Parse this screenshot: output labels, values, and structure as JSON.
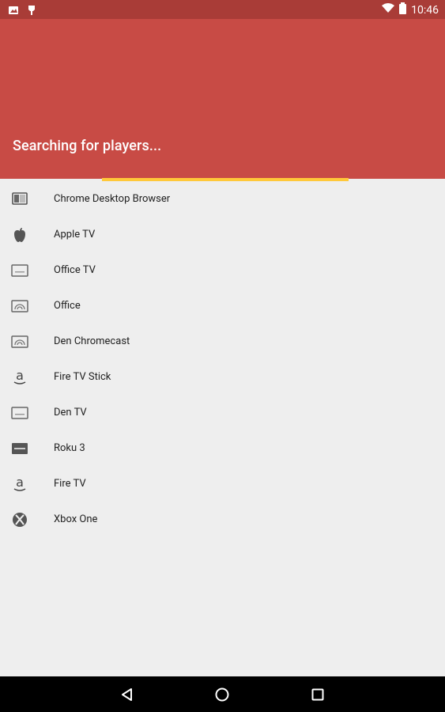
{
  "status_bar": {
    "time": "10:46"
  },
  "header": {
    "title": "Searching for players..."
  },
  "players": [
    {
      "label": "Chrome Desktop Browser",
      "icon": "monitor-icon"
    },
    {
      "label": "Apple TV",
      "icon": "apple-icon"
    },
    {
      "label": "Office TV",
      "icon": "tv-icon"
    },
    {
      "label": "Office",
      "icon": "cast-icon"
    },
    {
      "label": "Den Chromecast",
      "icon": "cast-icon"
    },
    {
      "label": "Fire TV Stick",
      "icon": "amazon-icon"
    },
    {
      "label": "Den TV",
      "icon": "tv-icon"
    },
    {
      "label": "Roku 3",
      "icon": "roku-icon"
    },
    {
      "label": "Fire TV",
      "icon": "amazon-icon"
    },
    {
      "label": "Xbox One",
      "icon": "xbox-icon"
    }
  ],
  "colors": {
    "header": "#c84b45",
    "status_bar": "#a93c37",
    "progress": "#ffc83a"
  }
}
